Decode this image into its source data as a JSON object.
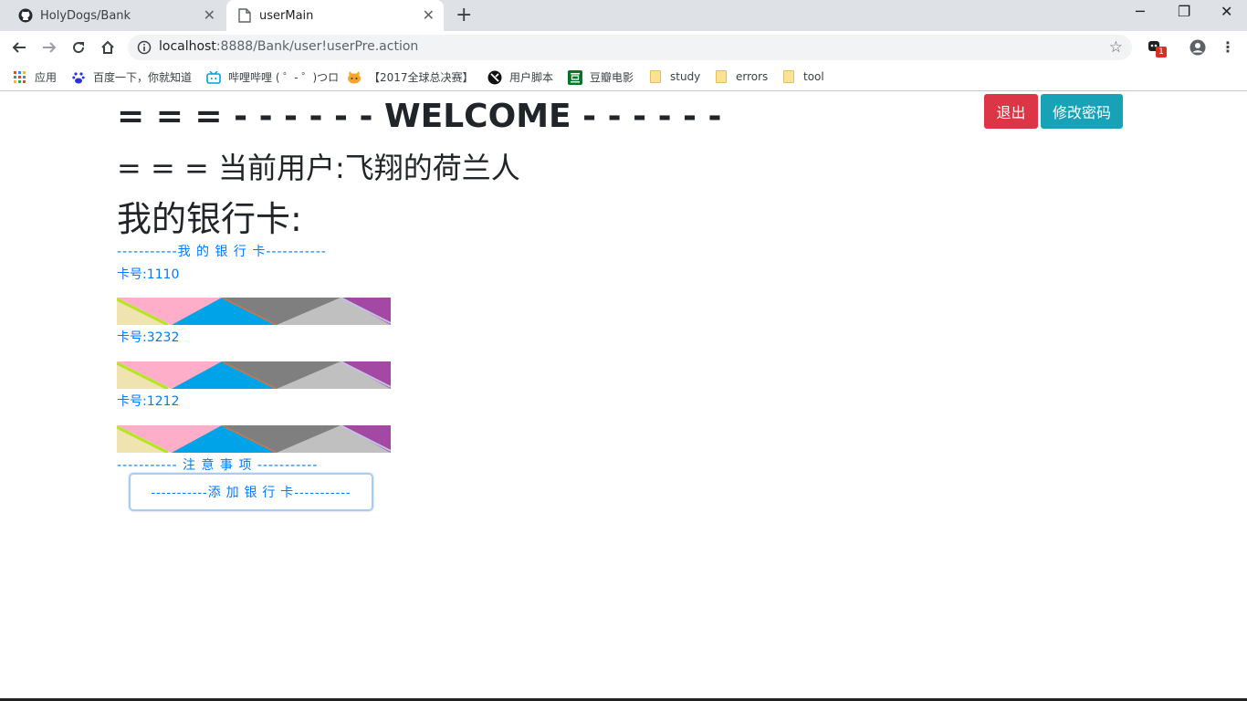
{
  "browser": {
    "tabs": [
      {
        "title": "HolyDogs/Bank",
        "icon": "github-icon"
      },
      {
        "title": "userMain",
        "icon": "page-icon"
      }
    ],
    "url_host": "localhost",
    "url_rest": ":8888/Bank/user!userPre.action",
    "extension_badge": "1",
    "bookmarks": [
      {
        "label": "应用",
        "icon": "apps-icon"
      },
      {
        "label": "百度一下，你就知道",
        "icon": "baidu-icon"
      },
      {
        "label": "哔哩哔哩 ( ゜- ゜)つロ",
        "icon": "bilibili-icon"
      },
      {
        "label": "【2017全球总决赛】",
        "icon": "cat-icon"
      },
      {
        "label": "用户脚本",
        "icon": "userscript-icon"
      },
      {
        "label": "豆瓣电影",
        "icon": "douban-icon"
      },
      {
        "label": "study",
        "icon": "folder-icon"
      },
      {
        "label": "errors",
        "icon": "folder-icon"
      },
      {
        "label": "tool",
        "icon": "folder-icon"
      }
    ]
  },
  "page": {
    "welcome": "= = = - - - - - - WELCOME - - - - - -",
    "current_user": "= = = 当前用户:飞翔的荷兰人",
    "my_cards_heading": "我的银行卡:",
    "logout_label": "退出",
    "change_password_label": "修改密码",
    "cards_section": "-----------我 的 银 行 卡-----------",
    "cards": [
      {
        "label": "卡号:1110"
      },
      {
        "label": "卡号:3232"
      },
      {
        "label": "卡号:1212"
      }
    ],
    "notice_section": "----------- 注 意 事 项 -----------",
    "add_card_label": "-----------添 加 银 行 卡-----------"
  },
  "colors": {
    "danger": "#dc3545",
    "info": "#17a2b8",
    "link": "#007bff"
  }
}
